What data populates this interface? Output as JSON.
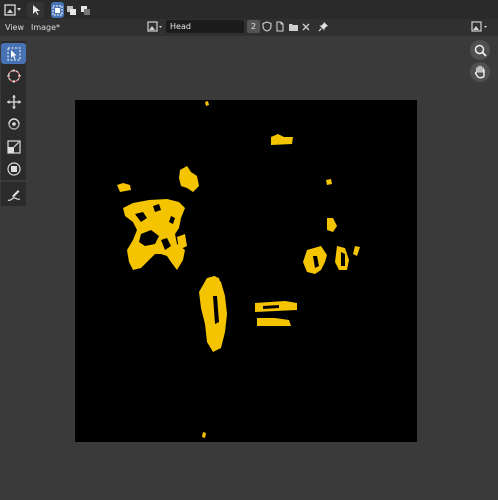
{
  "top_bar": {
    "editor_type_icon": "image-editor-icon",
    "select_mode_icon": "cursor-select-icon",
    "box_select_icons": [
      "select-box-icon",
      "select-extend-icon",
      "select-subtract-icon"
    ]
  },
  "header": {
    "menus": [
      "View",
      "Image*"
    ],
    "image_name": "Head",
    "user_count": "2",
    "icons": [
      "fake-user-shield-icon",
      "duplicate-image-icon",
      "open-folder-icon",
      "unlink-x-icon",
      "pin-icon"
    ],
    "display_icon": "display-channels-icon"
  },
  "toolbar": {
    "tools": [
      "select-tool-icon",
      "cursor-tool-icon",
      "move-tool-icon",
      "rotate-tool-icon",
      "scale-tool-icon",
      "transform-tool-icon",
      "annotate-tool-icon"
    ],
    "active_tool": "select-tool-icon"
  },
  "navigation": {
    "buttons": [
      "zoom-icon",
      "pan-hand-icon"
    ]
  },
  "canvas": {
    "background": "#000000",
    "mask_color": "#f5c400"
  }
}
